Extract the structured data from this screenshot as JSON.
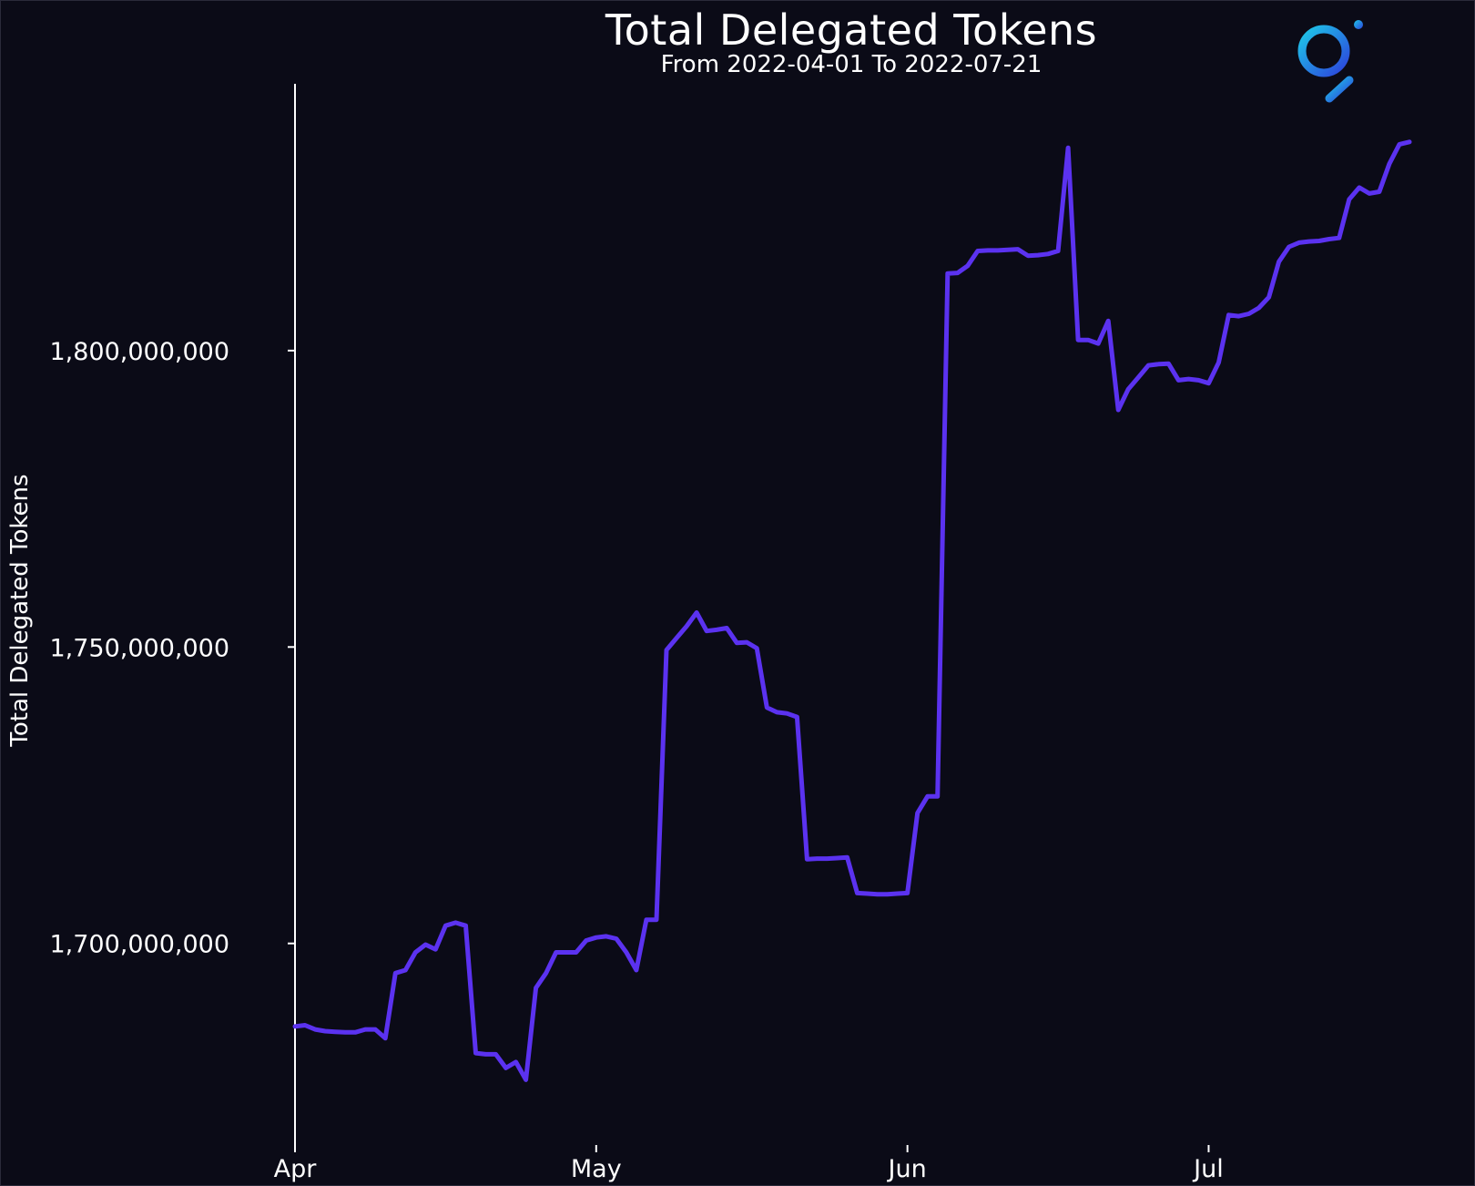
{
  "chart_data": {
    "type": "line",
    "title": "Total Delegated Tokens",
    "subtitle": "From 2022-04-01 To 2022-07-21",
    "xlabel": "",
    "ylabel": "Total Delegated Tokens",
    "x_tick_labels": [
      "Apr",
      "May",
      "Jun",
      "Jul"
    ],
    "x_tick_dates": [
      "2022-04-01",
      "2022-05-01",
      "2022-06-01",
      "2022-07-01"
    ],
    "y_tick_values": [
      1700000000,
      1750000000,
      1800000000
    ],
    "y_tick_labels": [
      "1,700,000,000",
      "1,750,000,000",
      "1,800,000,000"
    ],
    "xlim": [
      "2022-04-01",
      "2022-07-21"
    ],
    "ylim": [
      1666000000,
      1845000000
    ],
    "grid": false,
    "line_color": "#5b32f0",
    "background": "#0b0b17",
    "series": [
      {
        "name": "",
        "x": [
          "2022-04-01",
          "2022-04-02",
          "2022-04-03",
          "2022-04-04",
          "2022-04-05",
          "2022-04-06",
          "2022-04-07",
          "2022-04-08",
          "2022-04-09",
          "2022-04-10",
          "2022-04-11",
          "2022-04-12",
          "2022-04-13",
          "2022-04-14",
          "2022-04-15",
          "2022-04-16",
          "2022-04-17",
          "2022-04-18",
          "2022-04-19",
          "2022-04-20",
          "2022-04-21",
          "2022-04-22",
          "2022-04-23",
          "2022-04-24",
          "2022-04-25",
          "2022-04-26",
          "2022-04-27",
          "2022-04-28",
          "2022-04-29",
          "2022-04-30",
          "2022-05-01",
          "2022-05-02",
          "2022-05-03",
          "2022-05-04",
          "2022-05-05",
          "2022-05-06",
          "2022-05-07",
          "2022-05-08",
          "2022-05-09",
          "2022-05-10",
          "2022-05-11",
          "2022-05-12",
          "2022-05-13",
          "2022-05-14",
          "2022-05-15",
          "2022-05-16",
          "2022-05-17",
          "2022-05-18",
          "2022-05-19",
          "2022-05-20",
          "2022-05-21",
          "2022-05-22",
          "2022-05-23",
          "2022-05-24",
          "2022-05-25",
          "2022-05-26",
          "2022-05-27",
          "2022-05-28",
          "2022-05-29",
          "2022-05-30",
          "2022-05-31",
          "2022-06-01",
          "2022-06-02",
          "2022-06-03",
          "2022-06-04",
          "2022-06-05",
          "2022-06-06",
          "2022-06-07",
          "2022-06-08",
          "2022-06-09",
          "2022-06-10",
          "2022-06-11",
          "2022-06-12",
          "2022-06-13",
          "2022-06-14",
          "2022-06-15",
          "2022-06-16",
          "2022-06-17",
          "2022-06-18",
          "2022-06-19",
          "2022-06-20",
          "2022-06-21",
          "2022-06-22",
          "2022-06-23",
          "2022-06-24",
          "2022-06-25",
          "2022-06-26",
          "2022-06-27",
          "2022-06-28",
          "2022-06-29",
          "2022-06-30",
          "2022-07-01",
          "2022-07-02",
          "2022-07-03",
          "2022-07-04",
          "2022-07-05",
          "2022-07-06",
          "2022-07-07",
          "2022-07-08",
          "2022-07-09",
          "2022-07-10",
          "2022-07-11",
          "2022-07-12",
          "2022-07-13",
          "2022-07-14",
          "2022-07-15",
          "2022-07-16",
          "2022-07-17",
          "2022-07-18",
          "2022-07-19",
          "2022-07-20",
          "2022-07-21"
        ],
        "y": [
          1686000000,
          1686200000,
          1685500000,
          1685200000,
          1685100000,
          1685000000,
          1685000000,
          1685500000,
          1685500000,
          1684000000,
          1695000000,
          1695500000,
          1698500000,
          1699800000,
          1699000000,
          1703000000,
          1703500000,
          1703000000,
          1681500000,
          1681300000,
          1681300000,
          1679000000,
          1680000000,
          1677000000,
          1692500000,
          1695000000,
          1698500000,
          1698500000,
          1698500000,
          1700500000,
          1701000000,
          1701200000,
          1700800000,
          1698500000,
          1695500000,
          1704000000,
          1704000000,
          1749500000,
          1751500000,
          1753500000,
          1755800000,
          1752700000,
          1752900000,
          1753200000,
          1750700000,
          1750800000,
          1749800000,
          1739800000,
          1739000000,
          1738800000,
          1738200000,
          1714200000,
          1714300000,
          1714300000,
          1714400000,
          1714500000,
          1708500000,
          1708400000,
          1708300000,
          1708300000,
          1708400000,
          1708500000,
          1722000000,
          1724800000,
          1724800000,
          1813000000,
          1813100000,
          1814300000,
          1816800000,
          1816900000,
          1816900000,
          1817000000,
          1817100000,
          1816000000,
          1816100000,
          1816300000,
          1816800000,
          1834200000,
          1801800000,
          1801800000,
          1801200000,
          1805000000,
          1790000000,
          1793500000,
          1795500000,
          1797500000,
          1797700000,
          1797800000,
          1795000000,
          1795200000,
          1795000000,
          1794500000,
          1798000000,
          1806000000,
          1805800000,
          1806200000,
          1807200000,
          1809000000,
          1815000000,
          1817500000,
          1818200000,
          1818400000,
          1818500000,
          1818800000,
          1819000000,
          1825500000,
          1827500000,
          1826500000,
          1826800000,
          1831500000,
          1834800000,
          1835200000
        ]
      }
    ]
  },
  "logo": {
    "icon": "magnifier-logo-icon",
    "gradient_start": "#1ec8e8",
    "gradient_end": "#2c43dc"
  }
}
